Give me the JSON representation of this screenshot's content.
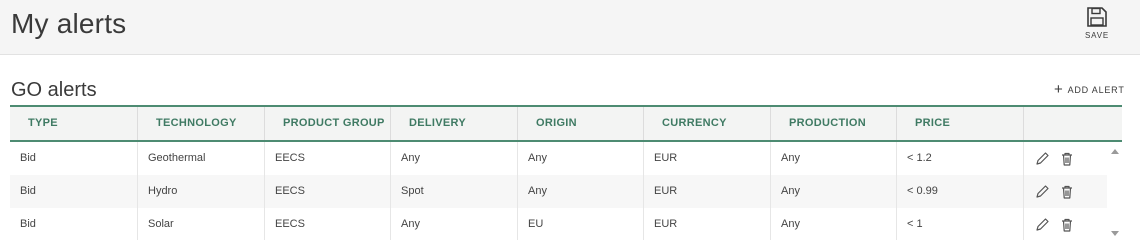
{
  "header": {
    "title": "My alerts",
    "save_label": "SAVE"
  },
  "section": {
    "title": "GO alerts",
    "add_label": "ADD ALERT"
  },
  "table": {
    "columns": [
      "TYPE",
      "TECHNOLOGY",
      "PRODUCT GROUP",
      "DELIVERY",
      "ORIGIN",
      "CURRENCY",
      "PRODUCTION",
      "PRICE",
      ""
    ],
    "rows": [
      [
        "Bid",
        "Geothermal",
        "EECS",
        "Any",
        "Any",
        "EUR",
        "Any",
        "< 1.2"
      ],
      [
        "Bid",
        "Hydro",
        "EECS",
        "Spot",
        "Any",
        "EUR",
        "Any",
        "< 0.99"
      ],
      [
        "Bid",
        "Solar",
        "EECS",
        "Any",
        "EU",
        "EUR",
        "Any",
        "< 1"
      ]
    ],
    "row_actions": [
      "edit-icon",
      "delete-icon"
    ]
  },
  "colors": {
    "accent": "#4d8b72",
    "header_text": "#3f7a63"
  }
}
